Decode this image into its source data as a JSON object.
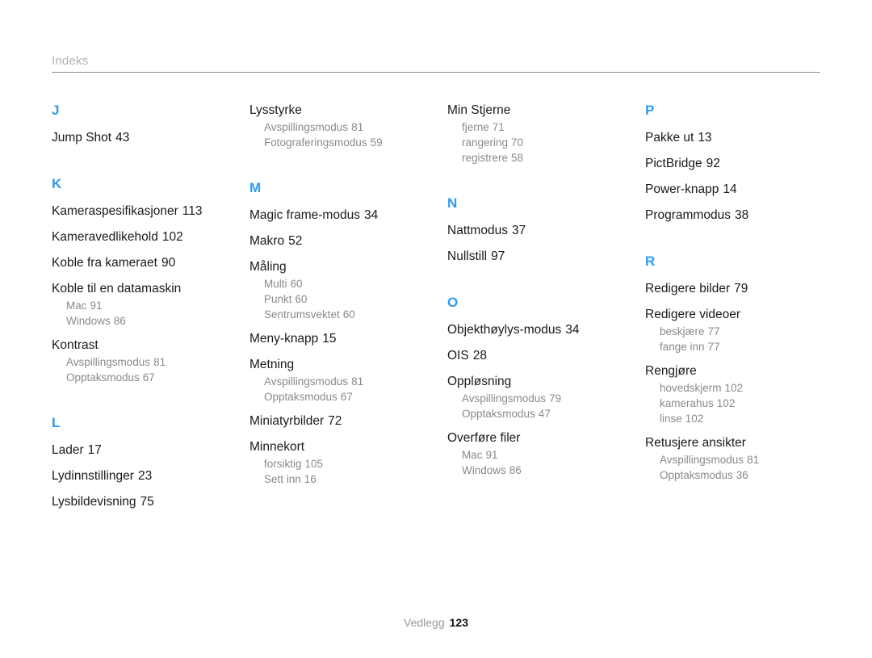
{
  "header": {
    "title": "Indeks"
  },
  "footer": {
    "label": "Vedlegg",
    "page_number": "123"
  },
  "colors": {
    "letter_heading": "#2e9cf0",
    "entry_text": "#1a1a1a",
    "subentry_text": "#8a8a8a",
    "header_title": "#b3b3b3",
    "rule": "#8c8c8c"
  },
  "columns": [
    {
      "id": "column-1",
      "blocks": [
        {
          "type": "letter",
          "label": "J"
        },
        {
          "type": "entry",
          "term": "Jump Shot",
          "page": "43",
          "subentries": []
        },
        {
          "type": "letter",
          "label": "K"
        },
        {
          "type": "entry",
          "term": "Kameraspesifikasjoner",
          "page": "113",
          "subentries": []
        },
        {
          "type": "entry",
          "term": "Kameravedlikehold",
          "page": "102",
          "subentries": []
        },
        {
          "type": "entry",
          "term": "Koble fra kameraet",
          "page": "90",
          "subentries": []
        },
        {
          "type": "entry",
          "term": "Koble til en datamaskin",
          "page": "",
          "subentries": [
            {
              "term": "Mac",
              "page": "91"
            },
            {
              "term": "Windows",
              "page": "86"
            }
          ]
        },
        {
          "type": "entry",
          "term": "Kontrast",
          "page": "",
          "subentries": [
            {
              "term": "Avspillingsmodus",
              "page": "81"
            },
            {
              "term": "Opptaksmodus",
              "page": "67"
            }
          ]
        },
        {
          "type": "letter",
          "label": "L"
        },
        {
          "type": "entry",
          "term": "Lader",
          "page": "17",
          "subentries": []
        },
        {
          "type": "entry",
          "term": "Lydinnstillinger",
          "page": "23",
          "subentries": []
        },
        {
          "type": "entry",
          "term": "Lysbildevisning",
          "page": "75",
          "subentries": []
        }
      ]
    },
    {
      "id": "column-2",
      "blocks": [
        {
          "type": "entry",
          "term": "Lysstyrke",
          "page": "",
          "subentries": [
            {
              "term": "Avspillingsmodus",
              "page": "81"
            },
            {
              "term": "Fotograferingsmodus",
              "page": "59"
            }
          ]
        },
        {
          "type": "letter",
          "label": "M"
        },
        {
          "type": "entry",
          "term": "Magic frame-modus",
          "page": "34",
          "subentries": []
        },
        {
          "type": "entry",
          "term": "Makro",
          "page": "52",
          "subentries": []
        },
        {
          "type": "entry",
          "term": "Måling",
          "page": "",
          "subentries": [
            {
              "term": "Multi",
              "page": "60"
            },
            {
              "term": "Punkt",
              "page": "60"
            },
            {
              "term": "Sentrumsvektet",
              "page": "60"
            }
          ]
        },
        {
          "type": "entry",
          "term": "Meny-knapp",
          "page": "15",
          "subentries": []
        },
        {
          "type": "entry",
          "term": "Metning",
          "page": "",
          "subentries": [
            {
              "term": "Avspillingsmodus",
              "page": "81"
            },
            {
              "term": "Opptaksmodus",
              "page": "67"
            }
          ]
        },
        {
          "type": "entry",
          "term": "Miniatyrbilder",
          "page": "72",
          "subentries": []
        },
        {
          "type": "entry",
          "term": "Minnekort",
          "page": "",
          "subentries": [
            {
              "term": "forsiktig",
              "page": "105"
            },
            {
              "term": "Sett inn",
              "page": "16"
            }
          ]
        }
      ]
    },
    {
      "id": "column-3",
      "blocks": [
        {
          "type": "entry",
          "term": "Min Stjerne",
          "page": "",
          "subentries": [
            {
              "term": "fjerne",
              "page": "71"
            },
            {
              "term": "rangering",
              "page": "70"
            },
            {
              "term": "registrere",
              "page": "58"
            }
          ]
        },
        {
          "type": "letter",
          "label": "N"
        },
        {
          "type": "entry",
          "term": "Nattmodus",
          "page": "37",
          "subentries": []
        },
        {
          "type": "entry",
          "term": "Nullstill",
          "page": "97",
          "subentries": []
        },
        {
          "type": "letter",
          "label": "O"
        },
        {
          "type": "entry",
          "term": "Objekthøylys-modus",
          "page": "34",
          "subentries": []
        },
        {
          "type": "entry",
          "term": "OIS",
          "page": "28",
          "subentries": []
        },
        {
          "type": "entry",
          "term": "Oppløsning",
          "page": "",
          "subentries": [
            {
              "term": "Avspillingsmodus",
              "page": "79"
            },
            {
              "term": "Opptaksmodus",
              "page": "47"
            }
          ]
        },
        {
          "type": "entry",
          "term": "Overføre filer",
          "page": "",
          "subentries": [
            {
              "term": "Mac",
              "page": "91"
            },
            {
              "term": "Windows",
              "page": "86"
            }
          ]
        }
      ]
    },
    {
      "id": "column-4",
      "blocks": [
        {
          "type": "letter",
          "label": "P"
        },
        {
          "type": "entry",
          "term": "Pakke ut",
          "page": "13",
          "subentries": []
        },
        {
          "type": "entry",
          "term": "PictBridge",
          "page": "92",
          "subentries": []
        },
        {
          "type": "entry",
          "term": "Power-knapp",
          "page": "14",
          "subentries": []
        },
        {
          "type": "entry",
          "term": "Programmodus",
          "page": "38",
          "subentries": []
        },
        {
          "type": "letter",
          "label": "R"
        },
        {
          "type": "entry",
          "term": "Redigere bilder",
          "page": "79",
          "subentries": []
        },
        {
          "type": "entry",
          "term": "Redigere videoer",
          "page": "",
          "subentries": [
            {
              "term": "beskjære",
              "page": "77"
            },
            {
              "term": "fange inn",
              "page": "77"
            }
          ]
        },
        {
          "type": "entry",
          "term": "Rengjøre",
          "page": "",
          "subentries": [
            {
              "term": "hovedskjerm",
              "page": "102"
            },
            {
              "term": "kamerahus",
              "page": "102"
            },
            {
              "term": "linse",
              "page": "102"
            }
          ]
        },
        {
          "type": "entry",
          "term": "Retusjere ansikter",
          "page": "",
          "subentries": [
            {
              "term": "Avspillingsmodus",
              "page": "81"
            },
            {
              "term": "Opptaksmodus",
              "page": "36"
            }
          ]
        }
      ]
    }
  ]
}
